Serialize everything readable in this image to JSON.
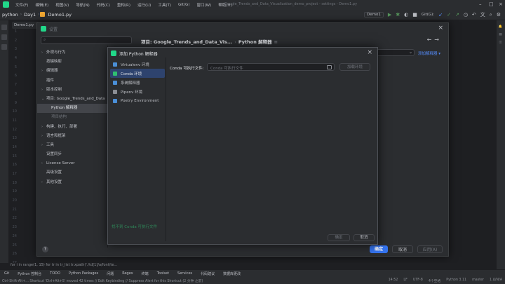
{
  "menubar": {
    "items": [
      "文件(F)",
      "编辑(E)",
      "视图(V)",
      "导航(N)",
      "代码(C)",
      "重构(R)",
      "运行(U)",
      "工具(T)",
      "Git(G)",
      "窗口(W)",
      "帮助(H)"
    ],
    "window_title": "Google_Trends_and_Data_Visualization_demo_project - settings - Demo1.py"
  },
  "navbar": {
    "breadcrumbs": [
      "python",
      "Day1",
      "Demo1.py"
    ],
    "run_config": "Demo1",
    "git_label": "Git(G):"
  },
  "editor": {
    "tab": "Demo1.py",
    "line_numbers": [
      "1",
      "2",
      "3",
      "4",
      "5",
      "6",
      "7",
      "8",
      "9",
      "10",
      "11",
      "12",
      "13",
      "14",
      "15",
      "16",
      "17",
      "18",
      "19",
      "20",
      "21",
      "22",
      "23",
      "24",
      "25",
      "26",
      "27"
    ]
  },
  "settings": {
    "title": "设置",
    "search_placeholder": "",
    "breadcrumb": [
      "项目: Google_Trends_and_Data_Vis...",
      "Python 解释器"
    ],
    "tree": [
      {
        "label": "外观与行为",
        "arrow": true
      },
      {
        "label": "按键映射",
        "arrow": false
      },
      {
        "label": "编辑器",
        "arrow": true
      },
      {
        "label": "插件",
        "arrow": false
      },
      {
        "label": "版本控制",
        "arrow": true
      },
      {
        "label": "项目: Google_Trends_and_Data",
        "arrow": true,
        "open": true
      },
      {
        "label": "Python 解释器",
        "sub": true,
        "selected": true
      },
      {
        "label": "项目结构",
        "sub": true,
        "dim": true
      },
      {
        "label": "构建、执行、部署",
        "arrow": true
      },
      {
        "label": "语言和框架",
        "arrow": true
      },
      {
        "label": "工具",
        "arrow": true
      },
      {
        "label": "设置同步",
        "arrow": false
      },
      {
        "label": "License Server",
        "arrow": true
      },
      {
        "label": "高级设置",
        "arrow": false
      },
      {
        "label": "其他设置",
        "arrow": true
      }
    ],
    "add_interpreter_link": "添加解释器 ▾",
    "help": "?",
    "ok": "确定",
    "cancel": "取消",
    "apply": "应用(A)"
  },
  "add_python": {
    "title": "添加 Python 解释器",
    "types": [
      {
        "label": "Virtualenv 环境",
        "color": "#4a8fd8"
      },
      {
        "label": "Conda 环境",
        "color": "#2fbf71",
        "selected": true
      },
      {
        "label": "系统解释器",
        "color": "#4a8fd8"
      },
      {
        "label": "Pipenv 环境",
        "color": "#8b8e94"
      },
      {
        "label": "Poetry Environment",
        "color": "#4a8fd8"
      }
    ],
    "field_label": "Conda 可执行文件:",
    "field_placeholder": "Conda 可执行文件",
    "load_button": "加载环境",
    "link_text": "找不到 Conda 可执行文件",
    "ok": "确定",
    "cancel": "取消"
  },
  "code_crumb": "for i in range(1, 15)    for tr in tr_list    tr.xpath('./td[1]/a/font/te...",
  "toolwindows": [
    "Git",
    "Python 控制台",
    "TODO",
    "Python Packages",
    "问题",
    "Regex",
    "终端",
    "Toolset",
    "Services",
    "代码建议",
    "数据库更改"
  ],
  "status": {
    "message": "Ctrl-Shift-Alt+... Shortcut 'Ctrl+Alt+S' moved 42 times // Edit Keybinding // Suppress Alert for this Shortcut (2 分钟 之前)",
    "right": [
      "14:52",
      "LF",
      "UTF-8",
      "4个空格",
      "Python 3.11",
      "master",
      "1 Δ/N/A"
    ]
  },
  "colors": {
    "accent": "#3574f0",
    "bg": "#1e1f22",
    "panel": "#2b2d30",
    "selection": "#2e436e",
    "link_green": "#2e8a59"
  }
}
